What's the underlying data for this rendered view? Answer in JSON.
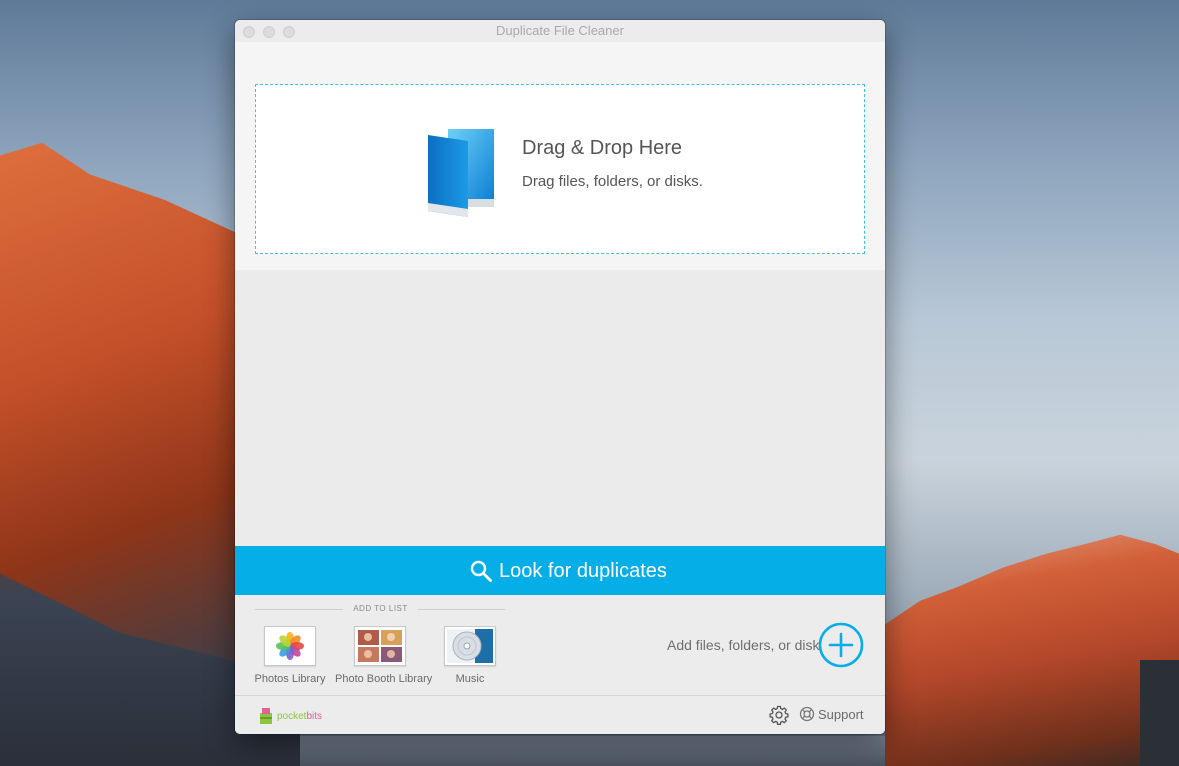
{
  "window": {
    "title": "Duplicate File Cleaner"
  },
  "drop_zone": {
    "title": "Drag & Drop Here",
    "subtitle": "Drag files, folders, or disks."
  },
  "action": {
    "look_label": "Look for duplicates"
  },
  "add_to_list": {
    "header": "ADD TO LIST",
    "items": [
      {
        "label": "Photos Library",
        "icon": "photos-icon"
      },
      {
        "label": "Photo Booth Library",
        "icon": "photo-booth-icon"
      },
      {
        "label": "Music",
        "icon": "music-icon"
      }
    ]
  },
  "add_files": {
    "label": "Add files, folders, or disk",
    "icon": "plus-circle-icon"
  },
  "footer": {
    "brand_prefix": "pocket",
    "brand_suffix": "bits",
    "support_label": "Support",
    "settings_icon": "gear-icon",
    "support_icon": "lifebuoy-icon"
  },
  "colors": {
    "accent": "#06aee8",
    "drop_border": "#3cc3ec",
    "brand_green": "#8cc63f",
    "brand_pink": "#e0609a"
  }
}
